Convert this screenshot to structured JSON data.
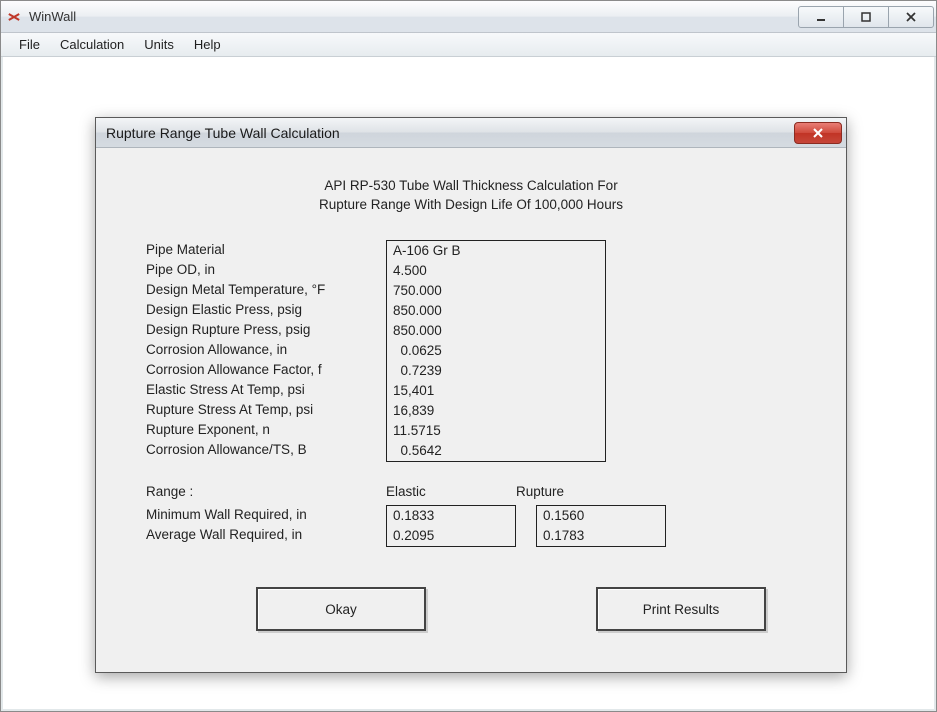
{
  "window": {
    "title": "WinWall",
    "menus": {
      "file": "File",
      "calculation": "Calculation",
      "units": "Units",
      "help": "Help"
    }
  },
  "dialog": {
    "title": "Rupture Range Tube Wall Calculation",
    "heading_line1": "API RP-530 Tube Wall Thickness Calculation For",
    "heading_line2": "Rupture Range With Design Life Of 100,000 Hours",
    "param_labels": {
      "pipe_material": "Pipe Material",
      "pipe_od": "Pipe OD, in",
      "design_metal_temp": "Design Metal Temperature, °F",
      "design_elastic_press": "Design Elastic Press, psig",
      "design_rupture_press": "Design Rupture Press, psig",
      "corrosion_allowance": "Corrosion Allowance, in",
      "corrosion_allowance_factor": "Corrosion Allowance Factor, f",
      "elastic_stress": "Elastic Stress At Temp, psi",
      "rupture_stress": "Rupture Stress At Temp, psi",
      "rupture_exponent": "Rupture Exponent, n",
      "corrosion_allowance_ts": "Corrosion Allowance/TS, B"
    },
    "param_values": {
      "pipe_material": "A-106 Gr B",
      "pipe_od": "4.500",
      "design_metal_temp": "750.000",
      "design_elastic_press": "850.000",
      "design_rupture_press": "850.000",
      "corrosion_allowance": "  0.0625",
      "corrosion_allowance_factor": "  0.7239",
      "elastic_stress": "15,401",
      "rupture_stress": "16,839",
      "rupture_exponent": "11.5715",
      "corrosion_allowance_ts": "  0.5642"
    },
    "range": {
      "label": "Range :",
      "elastic_label": "Elastic",
      "rupture_label": "Rupture",
      "min_wall_label": "Minimum Wall Required, in",
      "avg_wall_label": "Average Wall Required, in",
      "elastic_min": "0.1833",
      "elastic_avg": "0.2095",
      "rupture_min": "0.1560",
      "rupture_avg": "0.1783"
    },
    "buttons": {
      "okay": "Okay",
      "print": "Print Results"
    }
  }
}
